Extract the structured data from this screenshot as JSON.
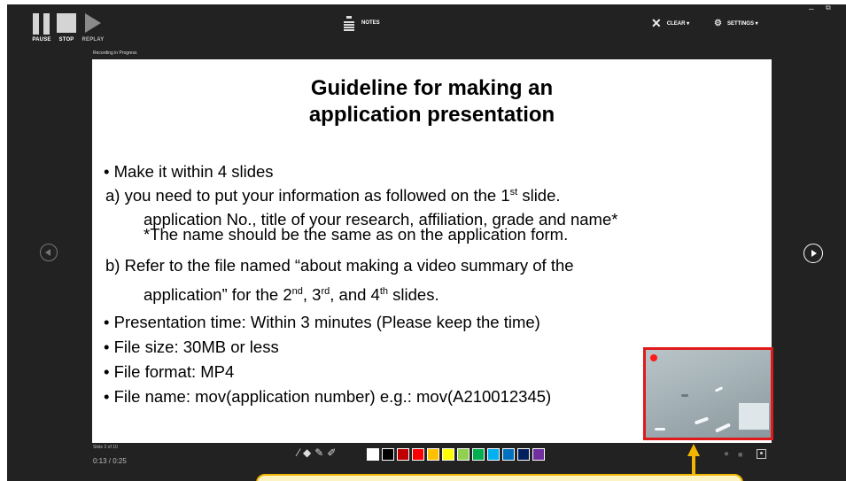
{
  "toolbar": {
    "pause_label": "PAUSE",
    "stop_label": "STOP",
    "replay_label": "REPLAY",
    "notes_label": "NOTES",
    "clear_label": "CLEAR ▾",
    "settings_label": "SETTINGS ▾"
  },
  "window_controls": {
    "minimize": "–",
    "restore": "⧉"
  },
  "status": {
    "recording": "Recording in Progress"
  },
  "slide": {
    "title_line1": "Guideline for making an",
    "title_line2": "application presentation",
    "b1": "• Make it within 4 slides",
    "a_pre": "a) you need to put your information as followed on the 1",
    "a_sup": "st",
    "a_post": " slide.",
    "a_detail": "application No., title of your research, affiliation, grade and name*",
    "a_note": "*The name should be the same as on the application form.",
    "b_line1": "b) Refer to the file named “about making a video summary of the",
    "b_line2_pre": "application” for the 2",
    "b_sup1": "nd",
    "b_mid1": ", 3",
    "b_sup2": "rd",
    "b_mid2": ", and 4",
    "b_sup3": "th",
    "b_post": " slides.",
    "b2": "• Presentation time: Within 3 minutes (Please keep the time)",
    "b3": "• File size: 30MB or less",
    "b4": "• File format: MP4",
    "b5": "• File name: mov(application number) e.g.: mov(A210012345)"
  },
  "footer": {
    "slide_counter": "Slide 2 of 10",
    "timer": "0:13 / 0:25"
  },
  "ink_palette": [
    "#ffffff",
    "#000000",
    "#c00000",
    "#ff0000",
    "#ffc000",
    "#ffff00",
    "#92d050",
    "#00b050",
    "#00b0f0",
    "#0070c0",
    "#002060",
    "#7030a0"
  ],
  "colors": {
    "frame_bg": "#222222",
    "record_border": "#e0191b",
    "callout_border": "#f2b600",
    "callout_fill": "#fdf4c4"
  }
}
